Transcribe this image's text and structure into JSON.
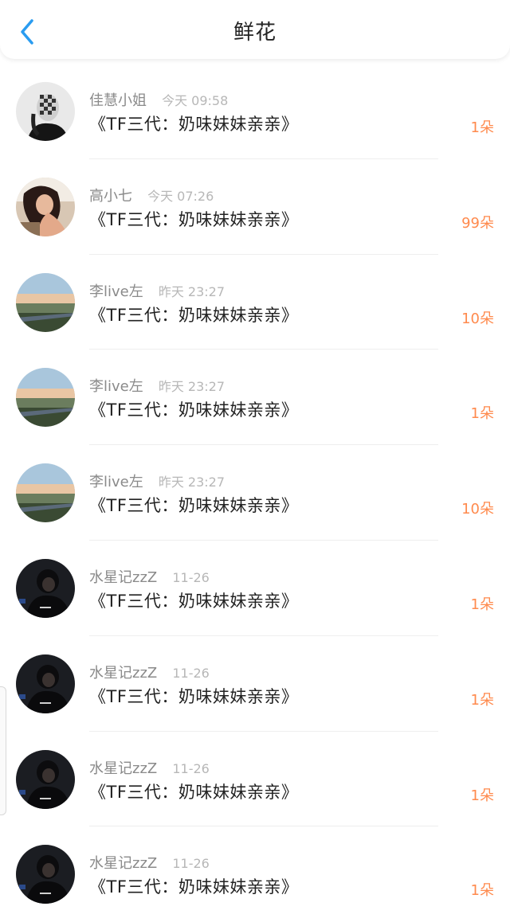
{
  "header": {
    "title": "鲜花",
    "back_icon": "chevron-left-icon",
    "accent": "#2a9cf0"
  },
  "colors": {
    "count": "#ff8a4d",
    "name": "#8a8a8a",
    "time": "#b7b7b7"
  },
  "items": [
    {
      "name": "佳慧小姐",
      "time": "今天 09:58",
      "work": "《TF三代：奶味妹妹亲亲》",
      "count": "1朵",
      "avatar": "woman-masked-avatar"
    },
    {
      "name": "高小七",
      "time": "今天 07:26",
      "work": "《TF三代：奶味妹妹亲亲》",
      "count": "99朵",
      "avatar": "woman-portrait-avatar"
    },
    {
      "name": "李live左",
      "time": "昨天 23:27",
      "work": "《TF三代：奶味妹妹亲亲》",
      "count": "10朵",
      "avatar": "sunset-landscape-avatar"
    },
    {
      "name": "李live左",
      "time": "昨天 23:27",
      "work": "《TF三代：奶味妹妹亲亲》",
      "count": "1朵",
      "avatar": "sunset-landscape-avatar"
    },
    {
      "name": "李live左",
      "time": "昨天 23:27",
      "work": "《TF三代：奶味妹妹亲亲》",
      "count": "10朵",
      "avatar": "sunset-landscape-avatar"
    },
    {
      "name": "水星记zzZ",
      "time": "11-26",
      "work": "《TF三代：奶味妹妹亲亲》",
      "count": "1朵",
      "avatar": "dark-figure-avatar"
    },
    {
      "name": "水星记zzZ",
      "time": "11-26",
      "work": "《TF三代：奶味妹妹亲亲》",
      "count": "1朵",
      "avatar": "dark-figure-avatar"
    },
    {
      "name": "水星记zzZ",
      "time": "11-26",
      "work": "《TF三代：奶味妹妹亲亲》",
      "count": "1朵",
      "avatar": "dark-figure-avatar"
    },
    {
      "name": "水星记zzZ",
      "time": "11-26",
      "work": "《TF三代：奶味妹妹亲亲》",
      "count": "1朵",
      "avatar": "dark-figure-avatar"
    }
  ]
}
